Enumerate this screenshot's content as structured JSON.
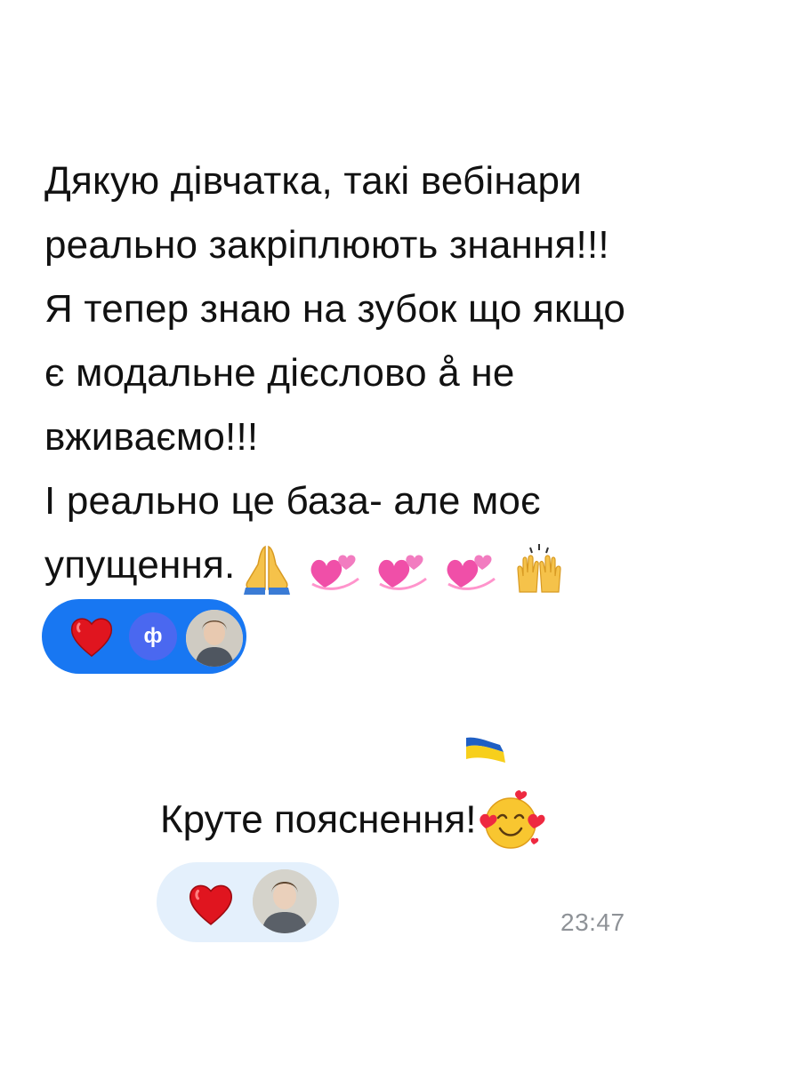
{
  "messages": {
    "first": {
      "lines": [
        "Дякую дівчатка, такі вебінари",
        "реально закріплюють знання!!!",
        "Я тепер знаю на зубок що якщо",
        "є модальне дієслово å не",
        "вживаємо!!!",
        "І реально це база- але моє",
        "упущення."
      ],
      "trailing_emojis": [
        "folded-hands",
        "revolving-hearts",
        "revolving-hearts",
        "revolving-hearts",
        "raising-hands"
      ]
    },
    "second": {
      "text": "Круте пояснення!",
      "trailing_emoji": "smiling-face-with-hearts"
    }
  },
  "reactions": {
    "first": {
      "emoji": "red-heart",
      "avatar_letter": "ф",
      "background_color": "#1877f2"
    },
    "second": {
      "emoji": "red-heart",
      "background_color": "#e4f0fc"
    }
  },
  "timestamp": "23:47",
  "colors": {
    "heart": "#e0151f",
    "timestamp": "#8e9297",
    "flag_blue": "#1f5fc4",
    "flag_yellow": "#f7cf1c"
  }
}
